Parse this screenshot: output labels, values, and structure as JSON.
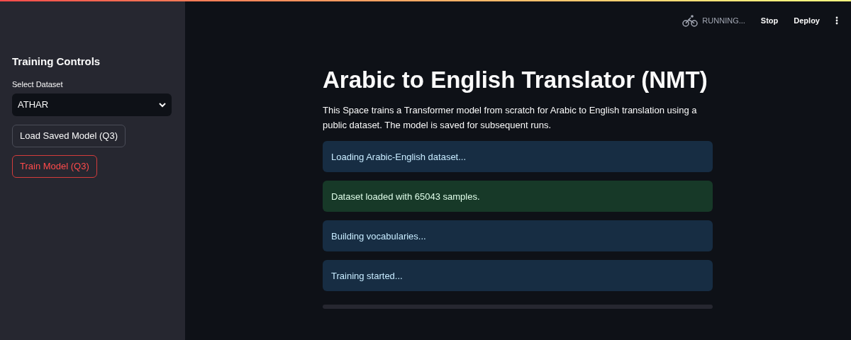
{
  "sidebar": {
    "title": "Training Controls",
    "dataset_select": {
      "label": "Select Dataset",
      "value": "ATHAR"
    },
    "buttons": [
      {
        "label": "Load Saved Model (Q3)",
        "kind": "secondary"
      },
      {
        "label": "Train Model (Q3)",
        "kind": "primary"
      }
    ]
  },
  "header": {
    "status": "RUNNING...",
    "actions": [
      "Stop",
      "Deploy"
    ]
  },
  "main": {
    "title": "Arabic to English Translator (NMT)",
    "description": "This Space trains a Transformer model from scratch for Arabic to English translation using a public dataset. The model is saved for subsequent runs.",
    "messages": [
      {
        "kind": "info",
        "text": "Loading Arabic-English dataset..."
      },
      {
        "kind": "success",
        "text": "Dataset loaded with 65043 samples."
      },
      {
        "kind": "info",
        "text": "Building vocabularies..."
      },
      {
        "kind": "info",
        "text": "Training started..."
      }
    ],
    "progress": {
      "level": 0
    }
  }
}
